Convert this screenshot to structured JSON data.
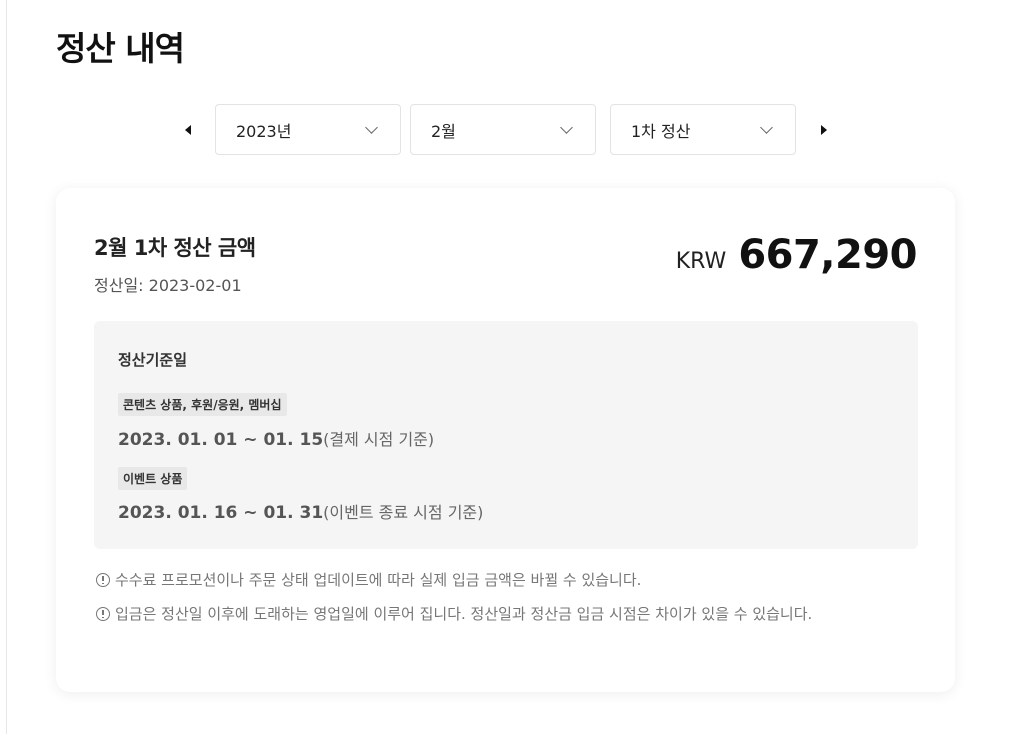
{
  "page": {
    "title": "정산 내역"
  },
  "filters": {
    "prev_label": "이전",
    "next_label": "다음",
    "year": "2023년",
    "month": "2월",
    "round": "1차 정산"
  },
  "summary": {
    "title": "2월 1차 정산 금액",
    "settle_date": "정산일: 2023-02-01",
    "currency": "KRW",
    "amount": "667,290"
  },
  "basis": {
    "title": "정산기준일",
    "items": [
      {
        "tag": "콘텐츠 상품, 후원/응원, 멤버십",
        "range": "2023. 01. 01 ~ 01. 15",
        "note": "(결제 시점 기준)"
      },
      {
        "tag": "이벤트 상품",
        "range": "2023. 01. 16 ~ 01. 31",
        "note": "(이벤트 종료 시점 기준)"
      }
    ]
  },
  "notices": [
    "수수료 프로모션이나 주문 상태 업데이트에 따라 실제 입금 금액은 바뀔 수 있습니다.",
    "입금은 정산일 이후에 도래하는 영업일에 이루어 집니다. 정산일과 정산금 입금 시점은 차이가 있을 수 있습니다."
  ]
}
